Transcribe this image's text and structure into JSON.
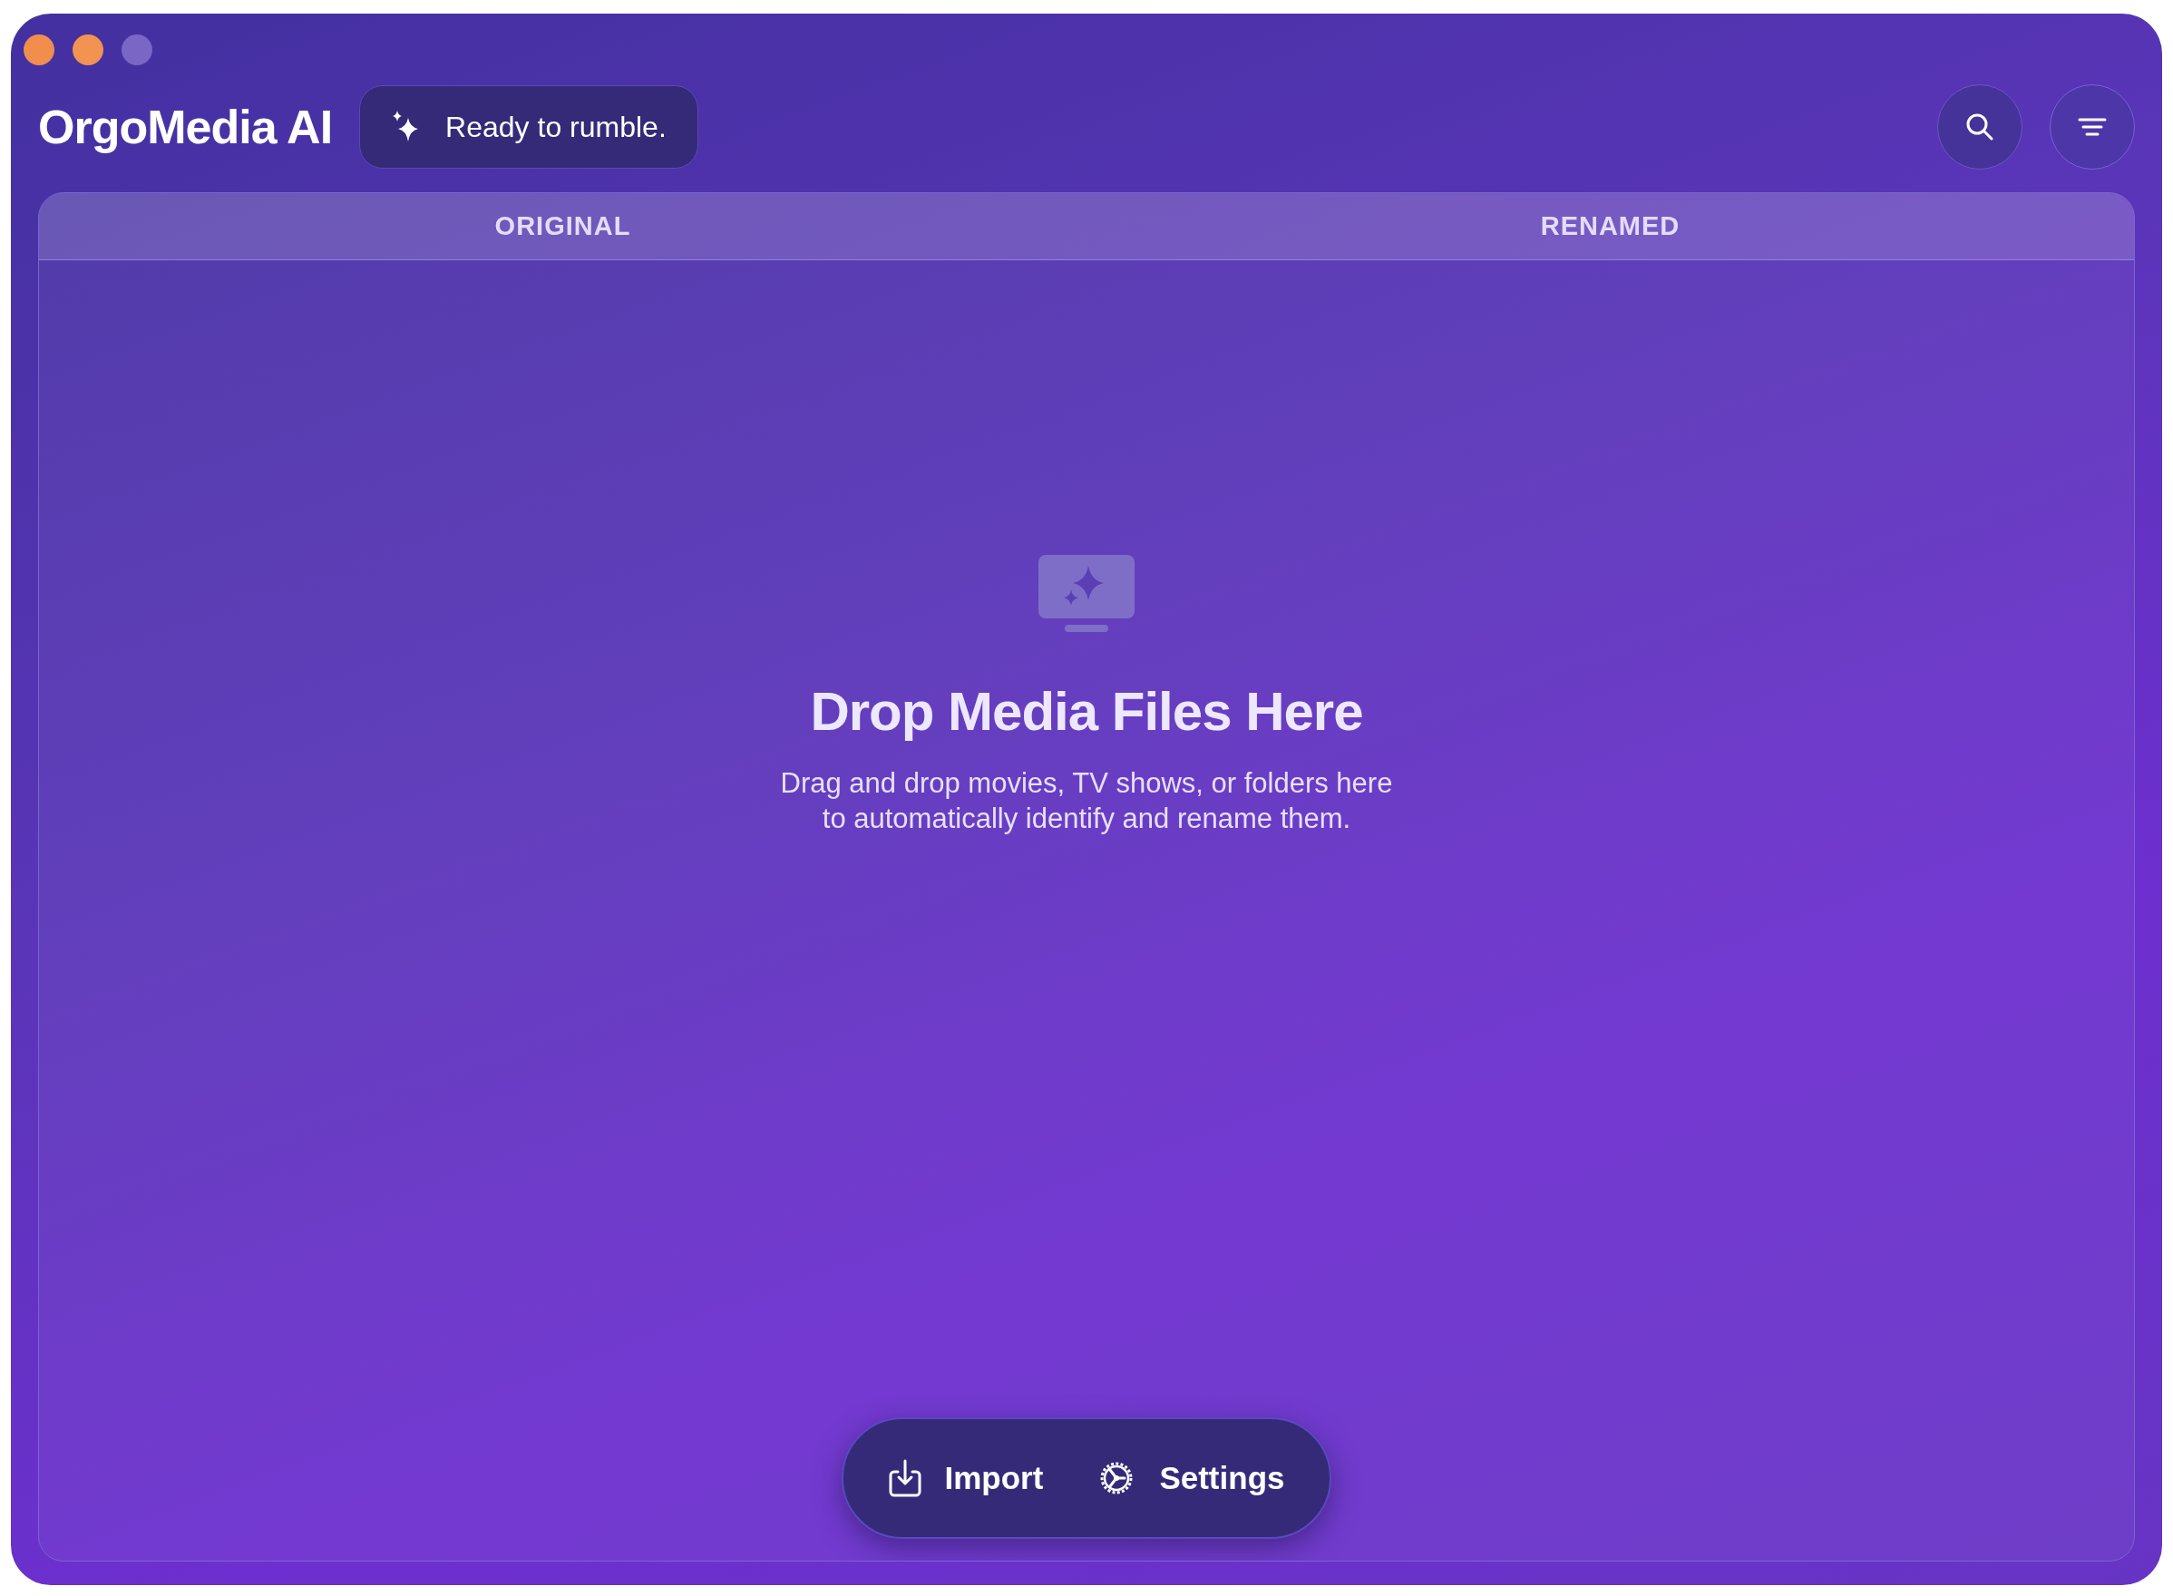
{
  "app": {
    "title": "OrgoMedia AI",
    "status": "Ready to rumble."
  },
  "table": {
    "columns": [
      "ORIGINAL",
      "RENAMED"
    ]
  },
  "empty_state": {
    "title": "Drop Media Files Here",
    "lines": [
      "Drag and drop movies, TV shows, or folders here",
      "to automatically identify and rename them."
    ]
  },
  "actions": [
    {
      "kind": "import",
      "label": "Import"
    },
    {
      "kind": "settings",
      "label": "Settings"
    }
  ]
}
